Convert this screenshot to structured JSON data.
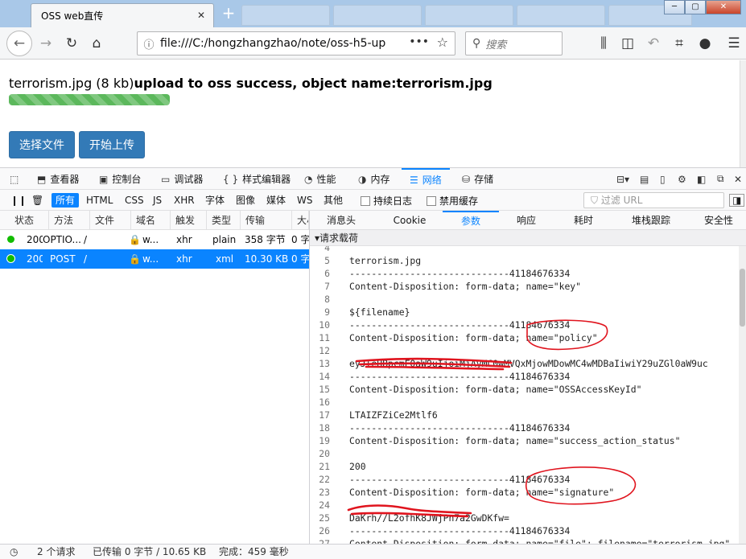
{
  "browser": {
    "tab_title": "OSS web直传",
    "url": "file:///C:/hongzhangzhao/note/oss-h5-up",
    "search_placeholder": "搜索"
  },
  "page": {
    "file_info": "terrorism.jpg (8 kb)",
    "upload_status": "upload to oss success, object name:terrorism.jpg",
    "progress": 1.0,
    "select_button": "选择文件",
    "start_button": "开始上传"
  },
  "devtools": {
    "tabs": [
      {
        "label": "查看器"
      },
      {
        "label": "控制台"
      },
      {
        "label": "调试器"
      },
      {
        "label": "样式编辑器"
      },
      {
        "label": "性能"
      },
      {
        "label": "内存"
      },
      {
        "label": "网络"
      },
      {
        "label": "存储"
      }
    ],
    "selected_tab": "网络",
    "filter_types": [
      "所有",
      "HTML",
      "CSS",
      "JS",
      "XHR",
      "字体",
      "图像",
      "媒体",
      "WS",
      "其他"
    ],
    "persist_logs": "持续日志",
    "disable_cache": "禁用缓存",
    "url_filter_placeholder": "过滤 URL",
    "columns": [
      "状态",
      "方法",
      "文件",
      "域名",
      "触发",
      "类型",
      "传输",
      "大小"
    ],
    "requests": [
      {
        "status": "200",
        "method": "OPTIO...",
        "file": "/",
        "domain": "w...",
        "cause": "xhr",
        "type": "plain",
        "transferred": "358 字节",
        "size": "0 字"
      },
      {
        "status": "200",
        "method": "POST",
        "file": "/",
        "domain": "w...",
        "cause": "xhr",
        "type": "xml",
        "transferred": "10.30 KB",
        "size": "0 字"
      }
    ],
    "detail_tabs": [
      "消息头",
      "Cookie",
      "参数",
      "响应",
      "耗时",
      "堆栈跟踪",
      "安全性"
    ],
    "selected_detail_tab": "参数",
    "payload_label": "请求载荷",
    "code_lines": [
      {
        "n": "4",
        "t": ""
      },
      {
        "n": "5",
        "t": "terrorism.jpg"
      },
      {
        "n": "6",
        "t": "-----------------------------41184676334"
      },
      {
        "n": "7",
        "t": "Content-Disposition: form-data; name=\"key\""
      },
      {
        "n": "8",
        "t": ""
      },
      {
        "n": "9",
        "t": "${filename}"
      },
      {
        "n": "10",
        "t": "-----------------------------41184676334"
      },
      {
        "n": "11",
        "t": "Content-Disposition: form-data; name=\"policy\""
      },
      {
        "n": "12",
        "t": ""
      },
      {
        "n": "13",
        "t": "eyJleHBpcmF0aW9uIjoiMjAyMC0wMVQxMjowMDowMC4wMDBaIiwiY29uZGl0aW9uc"
      },
      {
        "n": "14",
        "t": "-----------------------------41184676334"
      },
      {
        "n": "15",
        "t": "Content-Disposition: form-data; name=\"OSSAccessKeyId\""
      },
      {
        "n": "16",
        "t": ""
      },
      {
        "n": "17",
        "t": "LTAIZFZiCe2Mtlf6"
      },
      {
        "n": "18",
        "t": "-----------------------------41184676334"
      },
      {
        "n": "19",
        "t": "Content-Disposition: form-data; name=\"success_action_status\""
      },
      {
        "n": "20",
        "t": ""
      },
      {
        "n": "21",
        "t": "200"
      },
      {
        "n": "22",
        "t": "-----------------------------41184676334"
      },
      {
        "n": "23",
        "t": "Content-Disposition: form-data; name=\"signature\""
      },
      {
        "n": "24",
        "t": ""
      },
      {
        "n": "25",
        "t": "DaKrh//L2ofhK8JWjPn7a2GwDKfw="
      },
      {
        "n": "26",
        "t": "-----------------------------41184676334"
      },
      {
        "n": "27",
        "t": "Content-Disposition: form-data; name=\"file\"; filename=\"terrorism.jpg\""
      }
    ],
    "status_bar": {
      "requests": "2 个请求",
      "transferred": "已传输 0 字节 / 10.65 KB",
      "finish": "完成：459 毫秒"
    }
  },
  "colors": {
    "accent": "#0a84ff",
    "button": "#337ab7",
    "progress": "#5cb85c",
    "annotation": "#e0141e"
  }
}
